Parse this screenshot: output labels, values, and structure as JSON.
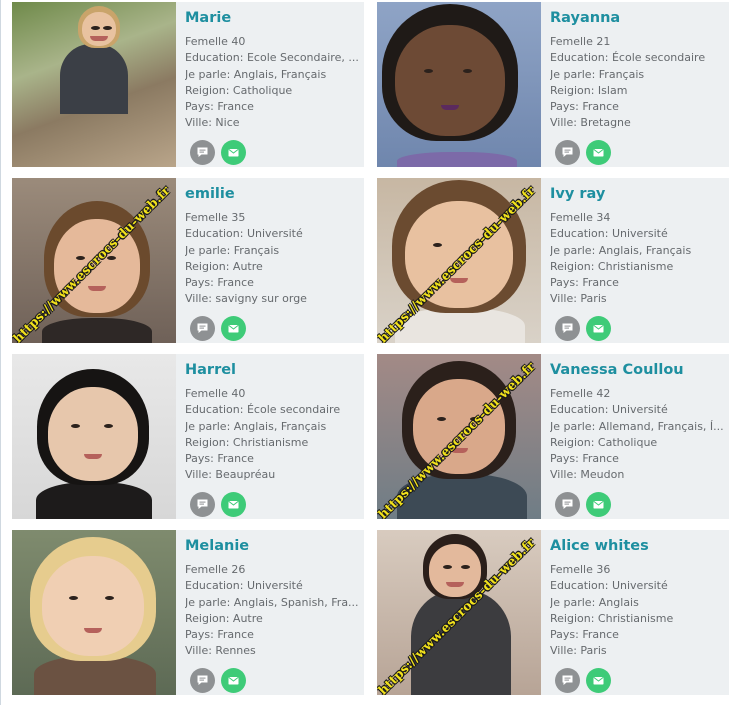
{
  "labels": {
    "education": "Education: ",
    "languages": "Je parle: ",
    "religion": "Reigion: ",
    "country": "Pays: ",
    "city": "Ville: "
  },
  "watermark_text": "https://www.escrocs-du-web.fr",
  "colors": {
    "name": "#1e8fa0",
    "card_bg": "#edf0f2",
    "message_button": "#8e9193",
    "mail_button": "#3ecb78",
    "watermark": "#f2e21c"
  },
  "icons": {
    "message": "chat-bubble-icon",
    "mail": "envelope-icon"
  },
  "profiles": [
    {
      "name": "Marie",
      "age_line": "Femelle 40",
      "education": "Ecole Secondaire, ...",
      "languages": "Anglais, Français",
      "religion": "Catholique",
      "country": "France",
      "city": "Nice",
      "watermarked": false
    },
    {
      "name": "Rayanna",
      "age_line": "Femelle 21",
      "education": "École secondaire",
      "languages": "Français",
      "religion": "Islam",
      "country": "France",
      "city": "Bretagne",
      "watermarked": false
    },
    {
      "name": "emilie",
      "age_line": "Femelle 35",
      "education": "Université",
      "languages": "Français",
      "religion": "Autre",
      "country": "France",
      "city": "savigny sur orge",
      "watermarked": true
    },
    {
      "name": "Ivy ray",
      "age_line": "Femelle 34",
      "education": "Université",
      "languages": "Anglais, Français",
      "religion": "Christianisme",
      "country": "France",
      "city": "Paris",
      "watermarked": true
    },
    {
      "name": "Harrel",
      "age_line": "Femelle 40",
      "education": "École secondaire",
      "languages": "Anglais, Français",
      "religion": "Christianisme",
      "country": "France",
      "city": "Beaupréau",
      "watermarked": false
    },
    {
      "name": "Vanessa Coullou",
      "age_line": "Femelle 42",
      "education": "Université",
      "languages": "Allemand, Français, Í...",
      "religion": "Catholique",
      "country": "France",
      "city": "Meudon",
      "watermarked": true
    },
    {
      "name": "Melanie",
      "age_line": "Femelle 26",
      "education": "Université",
      "languages": "Anglais, Spanish, Fra...",
      "religion": "Autre",
      "country": "France",
      "city": "Rennes",
      "watermarked": false
    },
    {
      "name": "Alice whites",
      "age_line": "Femelle 36",
      "education": "Université",
      "languages": "Anglais",
      "religion": "Christianisme",
      "country": "France",
      "city": "Paris",
      "watermarked": true
    }
  ]
}
